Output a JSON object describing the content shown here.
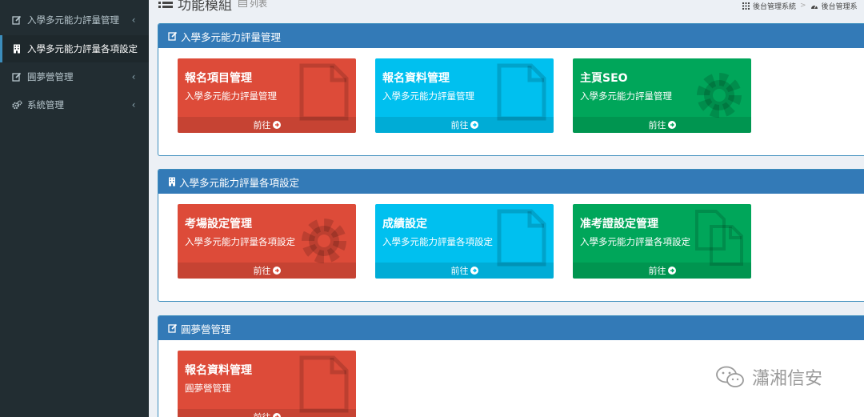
{
  "sidebar": {
    "items": [
      {
        "label": "入學多元能力評量管理",
        "icon": "edit-icon",
        "chevron": "‹"
      },
      {
        "label": "入學多元能力評量各項設定",
        "icon": "building-icon",
        "chevron": ""
      },
      {
        "label": "圓夢營管理",
        "icon": "edit-icon",
        "chevron": "‹"
      },
      {
        "label": "系統管理",
        "icon": "gears-icon",
        "chevron": "‹"
      }
    ]
  },
  "header": {
    "title": "功能模組",
    "subtitle": "列表",
    "breadcrumb": [
      "後台管理系統",
      "後台管理系"
    ]
  },
  "panels": [
    {
      "title": "入學多元能力評量管理",
      "icon": "edit-icon",
      "tiles": [
        {
          "title": "報名項目管理",
          "sub": "入學多元能力評量管理",
          "footer": "前往",
          "color": "#dd4b39",
          "bg_icon": "file-icon"
        },
        {
          "title": "報名資料管理",
          "sub": "入學多元能力評量管理",
          "footer": "前往",
          "color": "#00c0ef",
          "bg_icon": "file-icon"
        },
        {
          "title": "主頁SEO",
          "sub": "入學多元能力評量管理",
          "footer": "前往",
          "color": "#00a65a",
          "bg_icon": "gear-icon"
        }
      ]
    },
    {
      "title": "入學多元能力評量各項設定",
      "icon": "building-icon",
      "tiles": [
        {
          "title": "考場設定管理",
          "sub": "入學多元能力評量各項設定",
          "footer": "前往",
          "color": "#dd4b39",
          "bg_icon": "gear-icon"
        },
        {
          "title": "成績設定",
          "sub": "入學多元能力評量各項設定",
          "footer": "前往",
          "color": "#00c0ef",
          "bg_icon": "file-icon"
        },
        {
          "title": "准考證設定管理",
          "sub": "入學多元能力評量各項設定",
          "footer": "前往",
          "color": "#00a65a",
          "bg_icon": "files-icon"
        }
      ]
    },
    {
      "title": "圓夢營管理",
      "icon": "edit-icon",
      "tiles": [
        {
          "title": "報名資料管理",
          "sub": "圓夢營管理",
          "footer": "前往",
          "color": "#dd4b39",
          "bg_icon": "file-icon"
        }
      ]
    }
  ],
  "watermark": {
    "text": "瀟湘信安",
    "icon": "wechat-icon"
  },
  "colors": {
    "sidebar": "#222d32",
    "panel_head": "#337ab7",
    "red": "#dd4b39",
    "aqua": "#00c0ef",
    "green": "#00a65a"
  }
}
